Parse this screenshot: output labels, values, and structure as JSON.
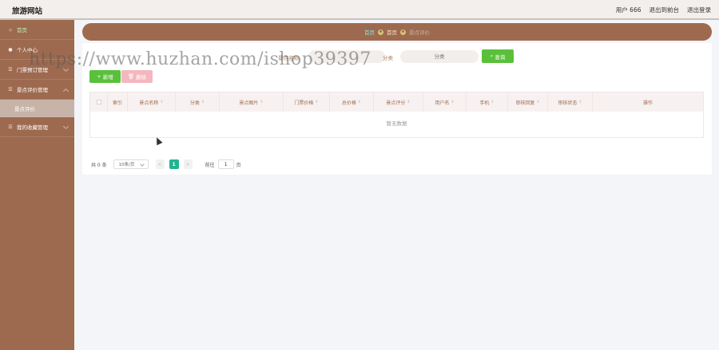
{
  "header": {
    "brand": "旅游网站",
    "user": "用户 666",
    "back_frontend": "退出到前台",
    "logout": "退出登录"
  },
  "sidebar": {
    "items": [
      {
        "label": "首页",
        "icon": "home-icon"
      },
      {
        "label": "个人中心",
        "icon": "user-icon"
      },
      {
        "label": "门票预订管理",
        "icon": "list-icon"
      },
      {
        "label": "景点评价管理",
        "icon": "list-icon"
      },
      {
        "label": "景点评价",
        "icon": ""
      },
      {
        "label": "我的收藏管理",
        "icon": "list-icon"
      }
    ]
  },
  "breadcrumb": {
    "home": "首页",
    "first": "首页",
    "current": "景点评价"
  },
  "search": {
    "field1_label": "景点名称",
    "field1_placeholder": "",
    "field2_label": "分类",
    "field2_placeholder": "分类",
    "button": "查询"
  },
  "actions": {
    "add": "新增",
    "delete": "删除"
  },
  "table": {
    "columns": [
      "索引",
      "景点名称",
      "分类",
      "景点图片",
      "门票价格",
      "总价格",
      "景点评分",
      "用户名",
      "手机",
      "审核回复",
      "审核状态",
      "操作"
    ],
    "empty_text": "暂无数据"
  },
  "pagination": {
    "total": "共 0 条",
    "page_size": "10条/页",
    "prev": "<",
    "current": "1",
    "next": ">",
    "goto_label": "前往",
    "goto_value": "1",
    "page_unit": "页"
  },
  "watermark": "https://www.huzhan.com/ishop39397",
  "colors": {
    "sidebar": "#9e6a4f",
    "accent_green": "#5ac03a",
    "page_active": "#21b38e"
  }
}
